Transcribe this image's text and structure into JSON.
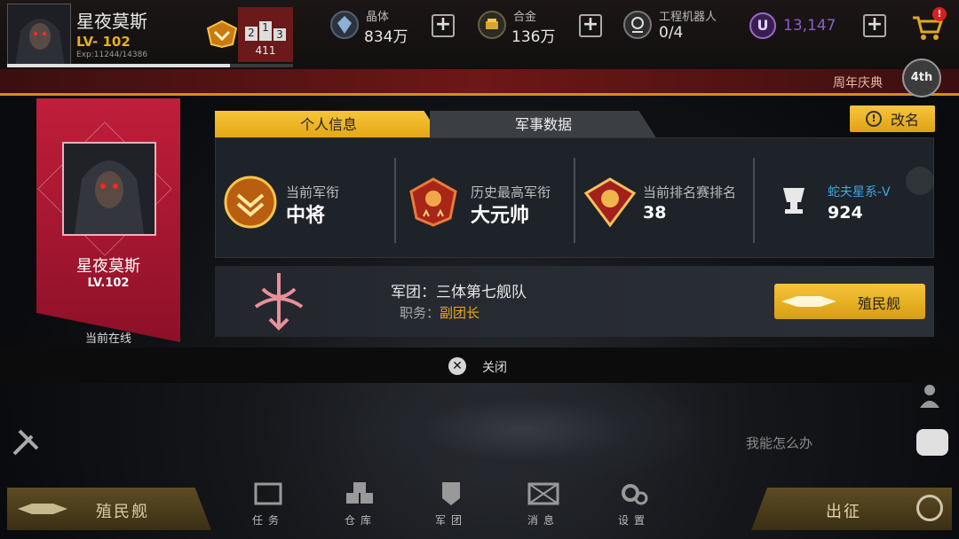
{
  "player": {
    "name": "星夜莫斯",
    "level": "LV- 102",
    "exp": "Exp:11244/14386",
    "exp_fraction": 0.78
  },
  "rank_badge": {
    "value": "411",
    "digits": [
      "2",
      "1",
      "3"
    ]
  },
  "resources": [
    {
      "name": "晶体",
      "value": "834万"
    },
    {
      "name": "合金",
      "value": "136万"
    },
    {
      "name": "工程机器人",
      "value": "0/4"
    },
    {
      "name": "",
      "value": "13,147"
    }
  ],
  "shop_badge": "!",
  "event": {
    "label": "周年庆典",
    "badge": "4th"
  },
  "card": {
    "name": "星夜莫斯",
    "level": "LV.102",
    "status": "当前在线"
  },
  "tabs": {
    "personal": "个人信息",
    "military": "军事数据"
  },
  "rename_label": "改名",
  "rename_icon": "!",
  "stats": [
    {
      "label": "当前军衔",
      "value": "中将"
    },
    {
      "label": "历史最高军衔",
      "value": "大元帅"
    },
    {
      "label": "当前排名赛排名",
      "value": "38"
    },
    {
      "label": "蛇夫星系-V",
      "value": "924"
    }
  ],
  "legion": {
    "name_label": "军团：",
    "name": "三体第七舰队",
    "role_label": "职务：",
    "role": "副团长",
    "colony_button": "殖民舰"
  },
  "close_label": "关闭",
  "side": {
    "help_text": "我能怎么办"
  },
  "bottom": {
    "left_button": "殖民舰",
    "right_button": "出征"
  },
  "nav": [
    {
      "label": "任务"
    },
    {
      "label": "仓库"
    },
    {
      "label": "军团"
    },
    {
      "label": "消息"
    },
    {
      "label": "设置"
    }
  ],
  "colors": {
    "accent": "#f2bb2c",
    "card_red": "#b81a34",
    "link_blue": "#3fa7e6",
    "role_gold": "#e8a919"
  }
}
